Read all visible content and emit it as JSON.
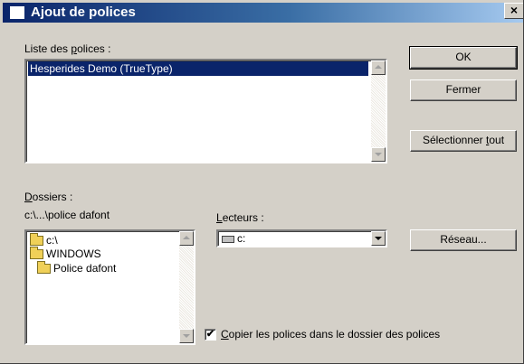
{
  "window": {
    "title": "Ajout de polices",
    "close_glyph": "×"
  },
  "fonts_list": {
    "label_pre": "Liste des ",
    "label_mnemonic": "p",
    "label_post": "olices :",
    "items": [
      "Hesperides Demo (TrueType)"
    ],
    "selected_index": 0
  },
  "buttons": {
    "ok": "OK",
    "close": "Fermer",
    "select_all_pre": "Sélectionner ",
    "select_all_mnemonic": "t",
    "select_all_post": "out",
    "network": "Réseau..."
  },
  "folders": {
    "label_mnemonic": "D",
    "label_post": "ossiers :",
    "current_path": "c:\\...\\police dafont",
    "tree": [
      "c:\\",
      "WINDOWS",
      "Police dafont"
    ]
  },
  "drives": {
    "label_mnemonic": "L",
    "label_post": "ecteurs :",
    "selected": "c:"
  },
  "copy_option": {
    "checked": true,
    "check_glyph": "✔",
    "label_mnemonic": "C",
    "label_post": "opier les polices dans le dossier des polices"
  },
  "icons": {
    "title": "window-icon",
    "folder": "folder-open-icon",
    "drive": "hard-drive-icon"
  }
}
